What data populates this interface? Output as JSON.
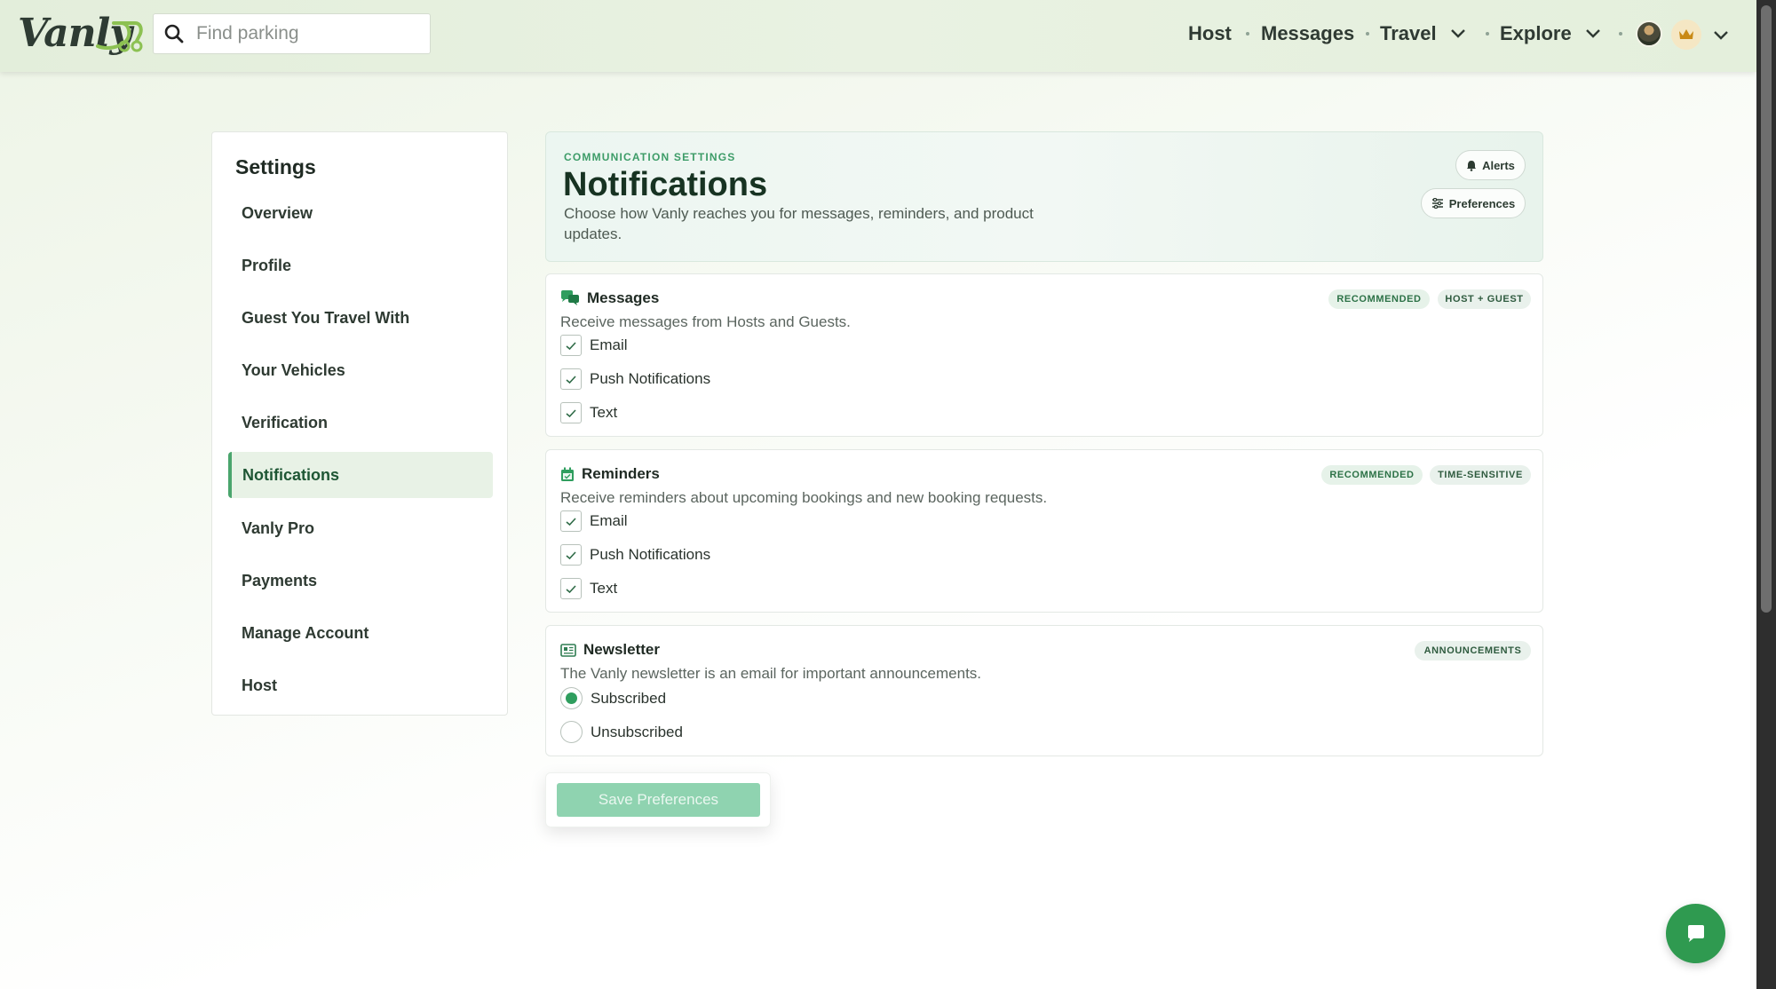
{
  "header": {
    "logo_text": "Vanly",
    "search_placeholder": "Find parking",
    "nav": {
      "host": "Host",
      "messages": "Messages",
      "travel": "Travel",
      "explore": "Explore"
    }
  },
  "sidebar": {
    "title": "Settings",
    "items": [
      {
        "label": "Overview"
      },
      {
        "label": "Profile"
      },
      {
        "label": "Guest You Travel With"
      },
      {
        "label": "Your Vehicles"
      },
      {
        "label": "Verification"
      },
      {
        "label": "Notifications",
        "active": true
      },
      {
        "label": "Vanly Pro"
      },
      {
        "label": "Payments"
      },
      {
        "label": "Manage Account"
      },
      {
        "label": "Host"
      }
    ]
  },
  "hero": {
    "eyebrow": "COMMUNICATION SETTINGS",
    "title": "Notifications",
    "description": "Choose how Vanly reaches you for messages, reminders, and product updates.",
    "alerts_button": "Alerts",
    "preferences_button": "Preferences"
  },
  "sections": {
    "messages": {
      "title": "Messages",
      "description": "Receive messages from Hosts and Guests.",
      "tags": [
        "RECOMMENDED",
        "HOST + GUEST"
      ],
      "options": [
        {
          "label": "Email",
          "checked": true
        },
        {
          "label": "Push Notifications",
          "checked": true
        },
        {
          "label": "Text",
          "checked": true
        }
      ]
    },
    "reminders": {
      "title": "Reminders",
      "description": "Receive reminders about upcoming bookings and new booking requests.",
      "tags": [
        "RECOMMENDED",
        "TIME-SENSITIVE"
      ],
      "options": [
        {
          "label": "Email",
          "checked": true
        },
        {
          "label": "Push Notifications",
          "checked": true
        },
        {
          "label": "Text",
          "checked": true
        }
      ]
    },
    "newsletter": {
      "title": "Newsletter",
      "description": "The Vanly newsletter is an email for important announcements.",
      "tags": [
        "ANNOUNCEMENTS"
      ],
      "options": [
        {
          "label": "Subscribed",
          "selected": true
        },
        {
          "label": "Unsubscribed",
          "selected": false
        }
      ]
    }
  },
  "save_button": "Save Preferences",
  "colors": {
    "accent": "#2f9e5e",
    "nav_bg": "#e6f0df",
    "save_disabled": "#8fd3b0",
    "chat_fab": "#2f9a50"
  },
  "icons": {
    "search": "search-icon",
    "chat": "chat-bubble-icon",
    "messages": "chat-bubbles-icon",
    "reminders": "calendar-icon",
    "newsletter": "newspaper-icon",
    "alerts": "bell-icon",
    "preferences": "sliders-icon",
    "pro": "crown-icon"
  }
}
